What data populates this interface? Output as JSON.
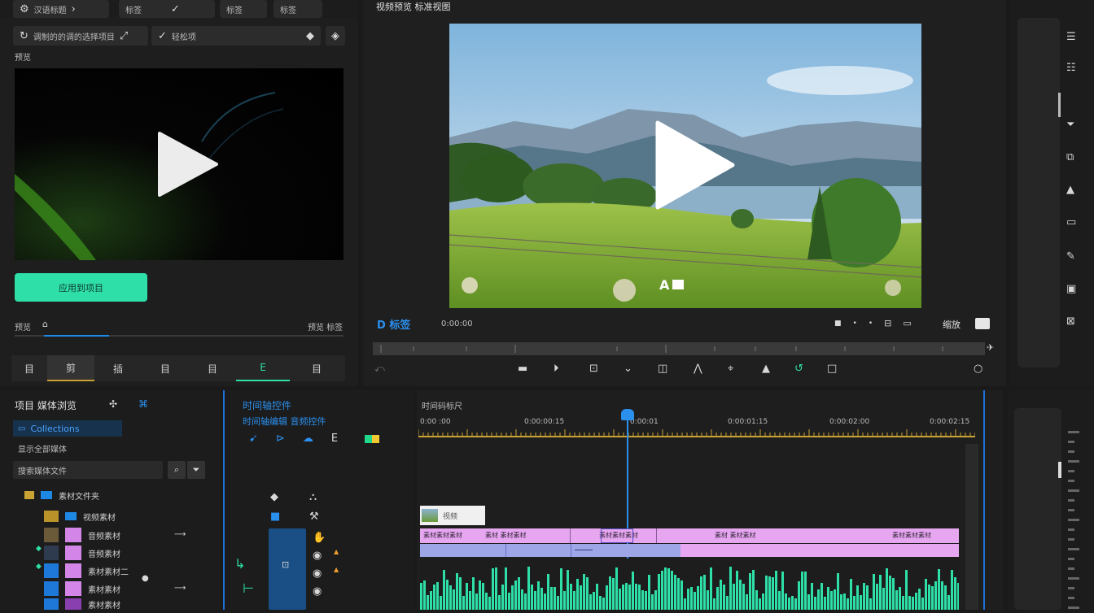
{
  "top_tabs": [
    "汉语标题",
    "标签",
    "标签",
    "标签"
  ],
  "left": {
    "effect_field": "调制的的调的选择项目",
    "effect_dropdown": "轻松项",
    "section_label": "预览",
    "apply_button": "应用到项目",
    "scrub_label": "预览",
    "scrub_value": "预览 标签",
    "bottom_tabs": [
      "目",
      "剪",
      "插",
      "目",
      "目",
      "E",
      "目"
    ]
  },
  "viewer": {
    "title": "视频预览 标准视图",
    "overlay_text": "A",
    "mode_label": "D 标签",
    "timecode": "0:00:00",
    "zoom_label": "缩放",
    "controls": [
      "prev",
      "play",
      "stop",
      "marker",
      "cut",
      "ripple",
      "fx",
      "color",
      "undo",
      "box",
      "search"
    ]
  },
  "project": {
    "title": "项目 媒体浏览",
    "selected_item": "Collections",
    "filter_label": "显示全部媒体",
    "search_label": "搜索媒体文件",
    "items": [
      "素材文件夹",
      "视频素材",
      "音频素材",
      "音频素材",
      "素材素材二",
      "素材素材",
      "素材素材"
    ]
  },
  "track_header": {
    "title": "时间轴控件",
    "subtitle": "时间轴编辑 音频控件"
  },
  "timeline": {
    "label": "时间码标尺",
    "ruler_labels": [
      "0:00 :00",
      "0:00:00:15",
      "0:00:01",
      "0:00:01:15",
      "0:00:02:00",
      "0:00:02:15"
    ],
    "clip_title": "视频",
    "pink_clips": [
      "素材素材素材",
      "素材 素材素材",
      "素材素材素材",
      "素材 素材素材",
      "素材素材素材"
    ]
  },
  "colors": {
    "accent": "#2ee0a8",
    "blue": "#1e88e5",
    "gold": "#c9a234",
    "pink": "#e6a6f0",
    "lavender": "#9fa6e8"
  }
}
